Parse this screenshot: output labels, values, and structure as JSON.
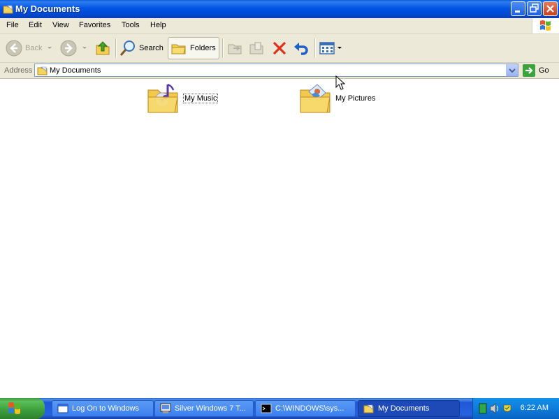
{
  "window": {
    "title": "My Documents",
    "controls": {
      "minimize": "minimize",
      "maximize": "restore",
      "close": "close"
    }
  },
  "menu": {
    "items": [
      "File",
      "Edit",
      "View",
      "Favorites",
      "Tools",
      "Help"
    ]
  },
  "toolbar": {
    "back_label": "Back",
    "search_label": "Search",
    "folders_label": "Folders",
    "icons": [
      "back-arrow-icon",
      "forward-arrow-icon",
      "up-folder-icon",
      "search-icon",
      "folders-icon",
      "move-to-icon",
      "copy-to-icon",
      "delete-icon",
      "undo-icon",
      "views-icon"
    ]
  },
  "address": {
    "label": "Address",
    "value": "My Documents",
    "go_label": "Go"
  },
  "folders": [
    {
      "name": "My Music",
      "icon": "music-folder-icon"
    },
    {
      "name": "My Pictures",
      "icon": "pictures-folder-icon"
    }
  ],
  "taskbar": {
    "tasks": [
      {
        "label": "Log On to Windows",
        "icon": "window-icon"
      },
      {
        "label": "Silver Windows 7 T...",
        "icon": "app-icon"
      },
      {
        "label": "C:\\WINDOWS\\sys...",
        "icon": "command-prompt-icon"
      },
      {
        "label": "My Documents",
        "icon": "folder-icon"
      }
    ],
    "clock": "6:22 AM"
  },
  "colors": {
    "titlebar": "#0055e5",
    "taskbar": "#245edb",
    "start": "#3a9d3a",
    "chrome": "#ece9d8"
  }
}
